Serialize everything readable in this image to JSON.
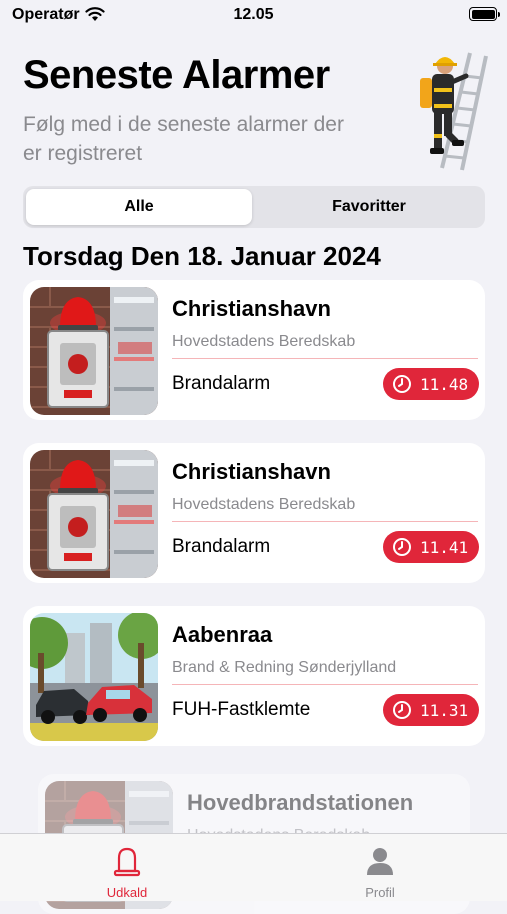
{
  "status_bar": {
    "carrier": "Operatør",
    "time": "12.05"
  },
  "header": {
    "title": "Seneste Alarmer",
    "subtitle": "Følg med i de seneste alarmer der er registreret"
  },
  "segments": {
    "all": "Alle",
    "favorites": "Favoritter",
    "selected": "Alle"
  },
  "section": {
    "date_heading": "Torsdag Den 18. Januar 2024"
  },
  "alarms": [
    {
      "location": "Christianshavn",
      "organization": "Hovedstadens Beredskab",
      "type": "Brandalarm",
      "time": "11.48",
      "image": "fire-alarm-icon"
    },
    {
      "location": "Christianshavn",
      "organization": "Hovedstadens Beredskab",
      "type": "Brandalarm",
      "time": "11.41",
      "image": "fire-alarm-icon"
    },
    {
      "location": "Aabenraa",
      "organization": "Brand & Redning Sønderjylland",
      "type": "FUH-Fastklemte",
      "time": "11.31",
      "image": "car-crash-icon"
    },
    {
      "location": "Hovedbrandstationen",
      "organization": "Hovedstadens Beredskab",
      "image": "fire-alarm-icon"
    }
  ],
  "tab_bar": {
    "tabs": [
      {
        "label": "Udkald",
        "icon": "siren-icon",
        "active": true
      },
      {
        "label": "Profil",
        "icon": "person-icon",
        "active": false
      }
    ]
  },
  "colors": {
    "accent": "#e0263a",
    "background": "#f2f2f7",
    "secondary_text": "#8a8a8e"
  }
}
